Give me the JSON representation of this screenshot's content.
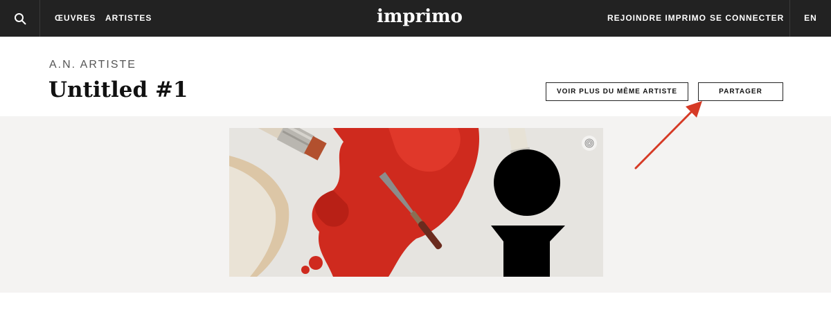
{
  "nav": {
    "search_icon": "search-icon",
    "works": "ŒUVRES",
    "artists": "ARTISTES",
    "brand": "imprimo",
    "join": "REJOINDRE IMPRIMO",
    "login": "SE CONNECTER",
    "language": "EN"
  },
  "artwork": {
    "artist": "A.N. ARTISTE",
    "title": "Untitled #1",
    "more_button": "VOIR PLUS DU MÊME ARTISTE",
    "share_button": "PARTAGER",
    "badge_icon": "fingerprint-icon"
  },
  "colors": {
    "nav_bg": "#222222",
    "gallery_bg": "#f4f3f2",
    "paint_red": "#d2261c",
    "annotation_arrow": "#d63a26"
  }
}
